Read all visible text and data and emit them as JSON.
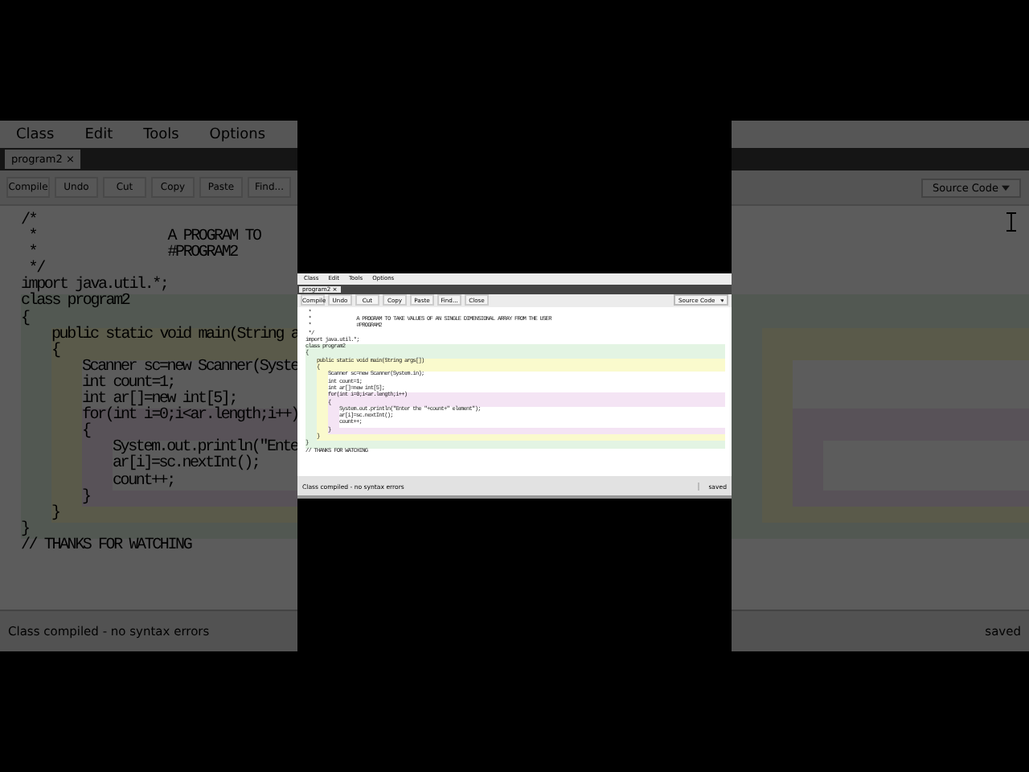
{
  "zoomed_view": {
    "menu": [
      "Class",
      "Edit",
      "Tools",
      "Options"
    ],
    "tab": {
      "label": "program2",
      "close": "×"
    },
    "toolbar": [
      "Compile",
      "Undo",
      "Cut",
      "Copy",
      "Paste",
      "Find..."
    ],
    "dropdown": "Source Code",
    "lines": [
      {
        "kind": "none",
        "text": "/*"
      },
      {
        "kind": "none",
        "text": " *                 A PROGRAM TO"
      },
      {
        "kind": "none",
        "text": " *                 #PROGRAM2"
      },
      {
        "kind": "none",
        "text": " */"
      },
      {
        "kind": "none",
        "text": "import java.util.*;"
      },
      {
        "kind": "class",
        "text": "class program2"
      },
      {
        "kind": "class",
        "text": "{"
      },
      {
        "kind": "method",
        "text": "public static void main(String a"
      },
      {
        "kind": "method",
        "text": "{"
      },
      {
        "kind": "method-body",
        "text": "Scanner sc=new Scanner(Syste"
      },
      {
        "kind": "method-body",
        "text": "int count=1;"
      },
      {
        "kind": "method-body",
        "text": "int ar[]=new int[5];"
      },
      {
        "kind": "loop",
        "text": "for(int i=0;i<ar.length;i++)"
      },
      {
        "kind": "loop",
        "text": "{"
      },
      {
        "kind": "loop-body",
        "text": "System.out.println(\"Ente"
      },
      {
        "kind": "loop-body",
        "text": "ar[i]=sc.nextInt();"
      },
      {
        "kind": "loop-body",
        "text": "count++;"
      },
      {
        "kind": "loop",
        "text": "}"
      },
      {
        "kind": "method",
        "text": "}"
      },
      {
        "kind": "class",
        "text": "}"
      },
      {
        "kind": "none",
        "text": "// THANKS FOR WATCHING"
      }
    ],
    "status": "Class compiled - no syntax errors",
    "status_right": "saved"
  },
  "window": {
    "menu": [
      "Class",
      "Edit",
      "Tools",
      "Options"
    ],
    "tab": {
      "label": "program2",
      "close": "×"
    },
    "toolbar": [
      "Compile",
      "Undo",
      "Cut",
      "Copy",
      "Paste",
      "Find...",
      "Close"
    ],
    "dropdown": "Source Code",
    "lines": [
      {
        "kind": "none",
        "text": " *"
      },
      {
        "kind": "none",
        "text": " *                A PROGRAM TO TAKE VALUES OF AN SINGLE DIMENSIONAL ARRAY FROM THE USER"
      },
      {
        "kind": "none",
        "text": " *                #PROGRAM2"
      },
      {
        "kind": "none",
        "text": " */"
      },
      {
        "kind": "none",
        "text": "import java.util.*;"
      },
      {
        "kind": "class",
        "text": "class program2"
      },
      {
        "kind": "class",
        "text": "{"
      },
      {
        "kind": "method",
        "text": "public static void main(String args[])"
      },
      {
        "kind": "method",
        "text": "{"
      },
      {
        "kind": "method-body",
        "text": "Scanner sc=new Scanner(System.in);"
      },
      {
        "kind": "method-body",
        "text": "int count=1;"
      },
      {
        "kind": "method-body",
        "text": "int ar[]=new int[5];"
      },
      {
        "kind": "loop",
        "text": "for(int i=0;i<ar.length;i++)"
      },
      {
        "kind": "loop",
        "text": "{"
      },
      {
        "kind": "loop-body",
        "text": "System.out.println(\"Enter the \"+count+\" element\");"
      },
      {
        "kind": "loop-body",
        "text": "ar[i]=sc.nextInt();"
      },
      {
        "kind": "loop-body",
        "text": "count++;"
      },
      {
        "kind": "loop",
        "text": "}"
      },
      {
        "kind": "method",
        "text": "}"
      },
      {
        "kind": "class",
        "text": "}"
      },
      {
        "kind": "none",
        "text": "// THANKS FOR WATCHING"
      }
    ],
    "status": "Class compiled - no syntax errors",
    "status_right": "saved"
  }
}
